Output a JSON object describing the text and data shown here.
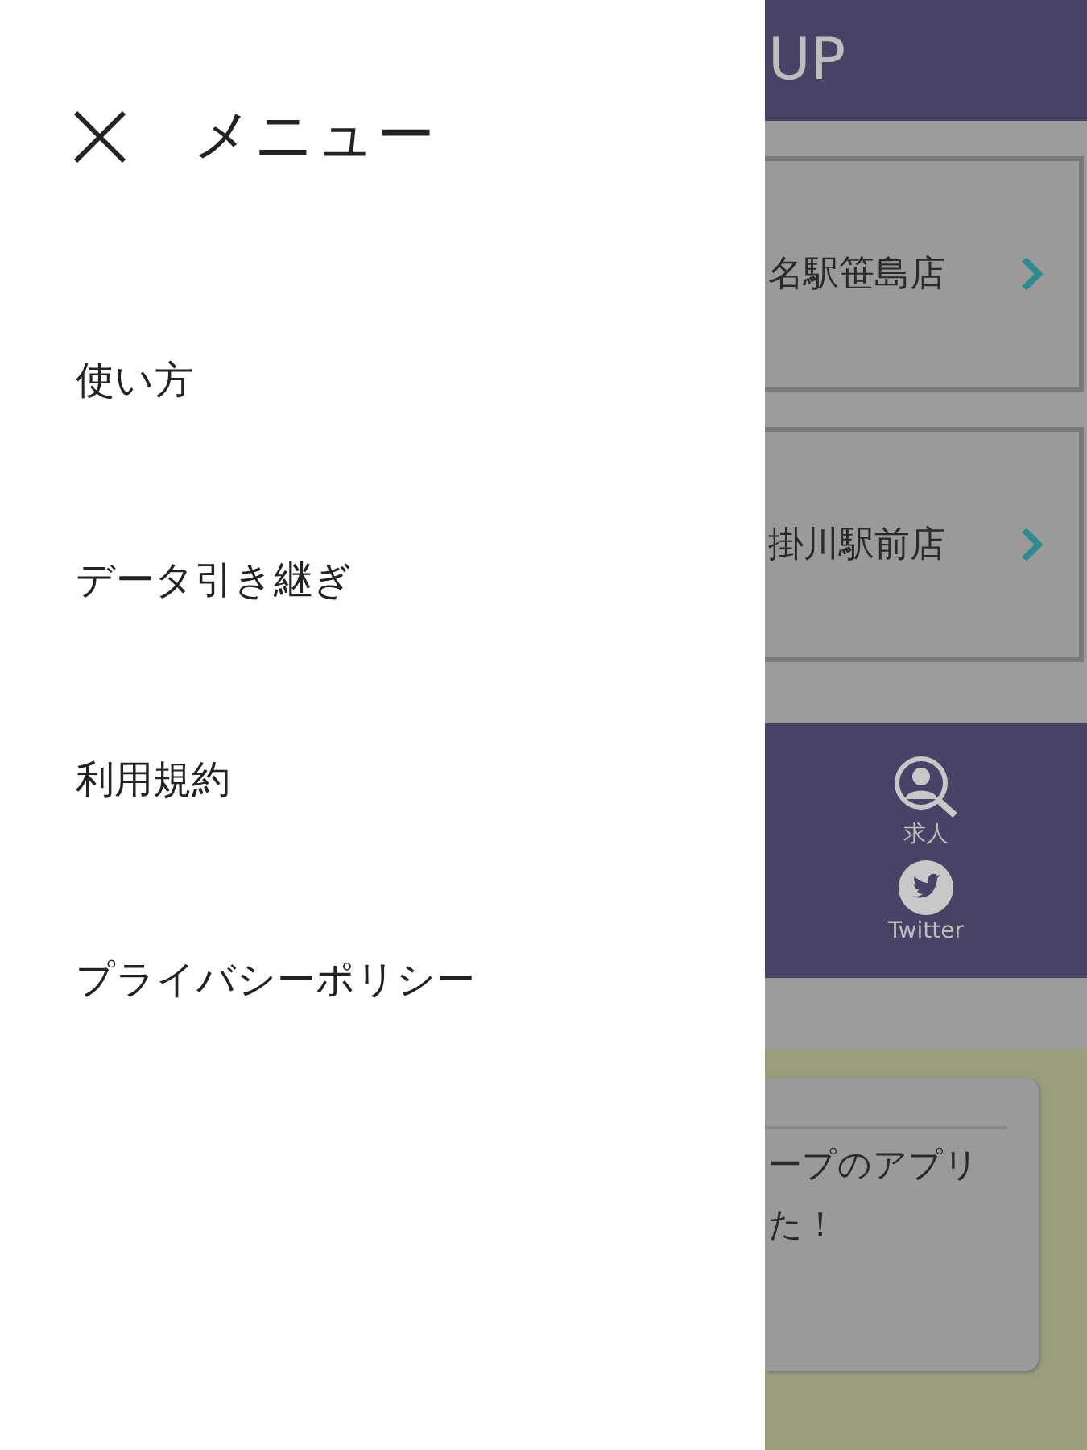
{
  "drawer": {
    "title": "メニュー",
    "items": [
      {
        "label": "使い方"
      },
      {
        "label": "データ引き継ぎ"
      },
      {
        "label": "利用規約"
      },
      {
        "label": "プライバシーポリシー"
      }
    ]
  },
  "background": {
    "header_title": "UP",
    "stores": [
      {
        "name": "名駅笹島店"
      },
      {
        "name": "掛川駅前店"
      }
    ],
    "nav": [
      {
        "kind": "jobs",
        "label": "求人"
      },
      {
        "kind": "twitter",
        "label": "Twitter"
      }
    ],
    "notice": {
      "lines": [
        "ープのアプリ",
        "た！"
      ]
    }
  }
}
